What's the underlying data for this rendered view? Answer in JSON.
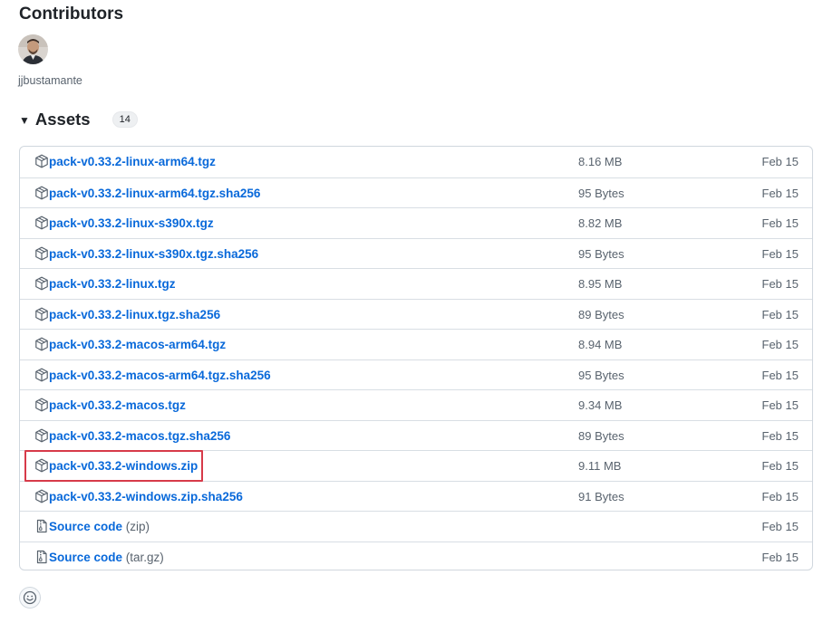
{
  "contributors": {
    "title": "Contributors",
    "users": [
      {
        "name": "jjbustamante"
      }
    ]
  },
  "assets": {
    "title": "Assets",
    "count": "14",
    "items": [
      {
        "name": "pack-v0.33.2-linux-arm64.tgz",
        "size": "8.16 MB",
        "date": "Feb 15",
        "icon": "package-icon"
      },
      {
        "name": "pack-v0.33.2-linux-arm64.tgz.sha256",
        "size": "95 Bytes",
        "date": "Feb 15",
        "icon": "package-icon"
      },
      {
        "name": "pack-v0.33.2-linux-s390x.tgz",
        "size": "8.82 MB",
        "date": "Feb 15",
        "icon": "package-icon"
      },
      {
        "name": "pack-v0.33.2-linux-s390x.tgz.sha256",
        "size": "95 Bytes",
        "date": "Feb 15",
        "icon": "package-icon"
      },
      {
        "name": "pack-v0.33.2-linux.tgz",
        "size": "8.95 MB",
        "date": "Feb 15",
        "icon": "package-icon"
      },
      {
        "name": "pack-v0.33.2-linux.tgz.sha256",
        "size": "89 Bytes",
        "date": "Feb 15",
        "icon": "package-icon"
      },
      {
        "name": "pack-v0.33.2-macos-arm64.tgz",
        "size": "8.94 MB",
        "date": "Feb 15",
        "icon": "package-icon"
      },
      {
        "name": "pack-v0.33.2-macos-arm64.tgz.sha256",
        "size": "95 Bytes",
        "date": "Feb 15",
        "icon": "package-icon"
      },
      {
        "name": "pack-v0.33.2-macos.tgz",
        "size": "9.34 MB",
        "date": "Feb 15",
        "icon": "package-icon"
      },
      {
        "name": "pack-v0.33.2-macos.tgz.sha256",
        "size": "89 Bytes",
        "date": "Feb 15",
        "icon": "package-icon"
      },
      {
        "name": "pack-v0.33.2-windows.zip",
        "size": "9.11 MB",
        "date": "Feb 15",
        "icon": "package-icon",
        "highlighted": true
      },
      {
        "name": "pack-v0.33.2-windows.zip.sha256",
        "size": "91 Bytes",
        "date": "Feb 15",
        "icon": "package-icon"
      },
      {
        "name": "Source code",
        "suffix": "(zip)",
        "size": "",
        "date": "Feb 15",
        "icon": "file-zip-icon"
      },
      {
        "name": "Source code",
        "suffix": "(tar.gz)",
        "size": "",
        "date": "Feb 15",
        "icon": "file-zip-icon"
      }
    ]
  },
  "colors": {
    "link": "#0969da",
    "muted": "#59636e",
    "border": "#d0d7de",
    "highlight": "#d73a49"
  },
  "reactions": {
    "icon": "smiley-icon"
  }
}
